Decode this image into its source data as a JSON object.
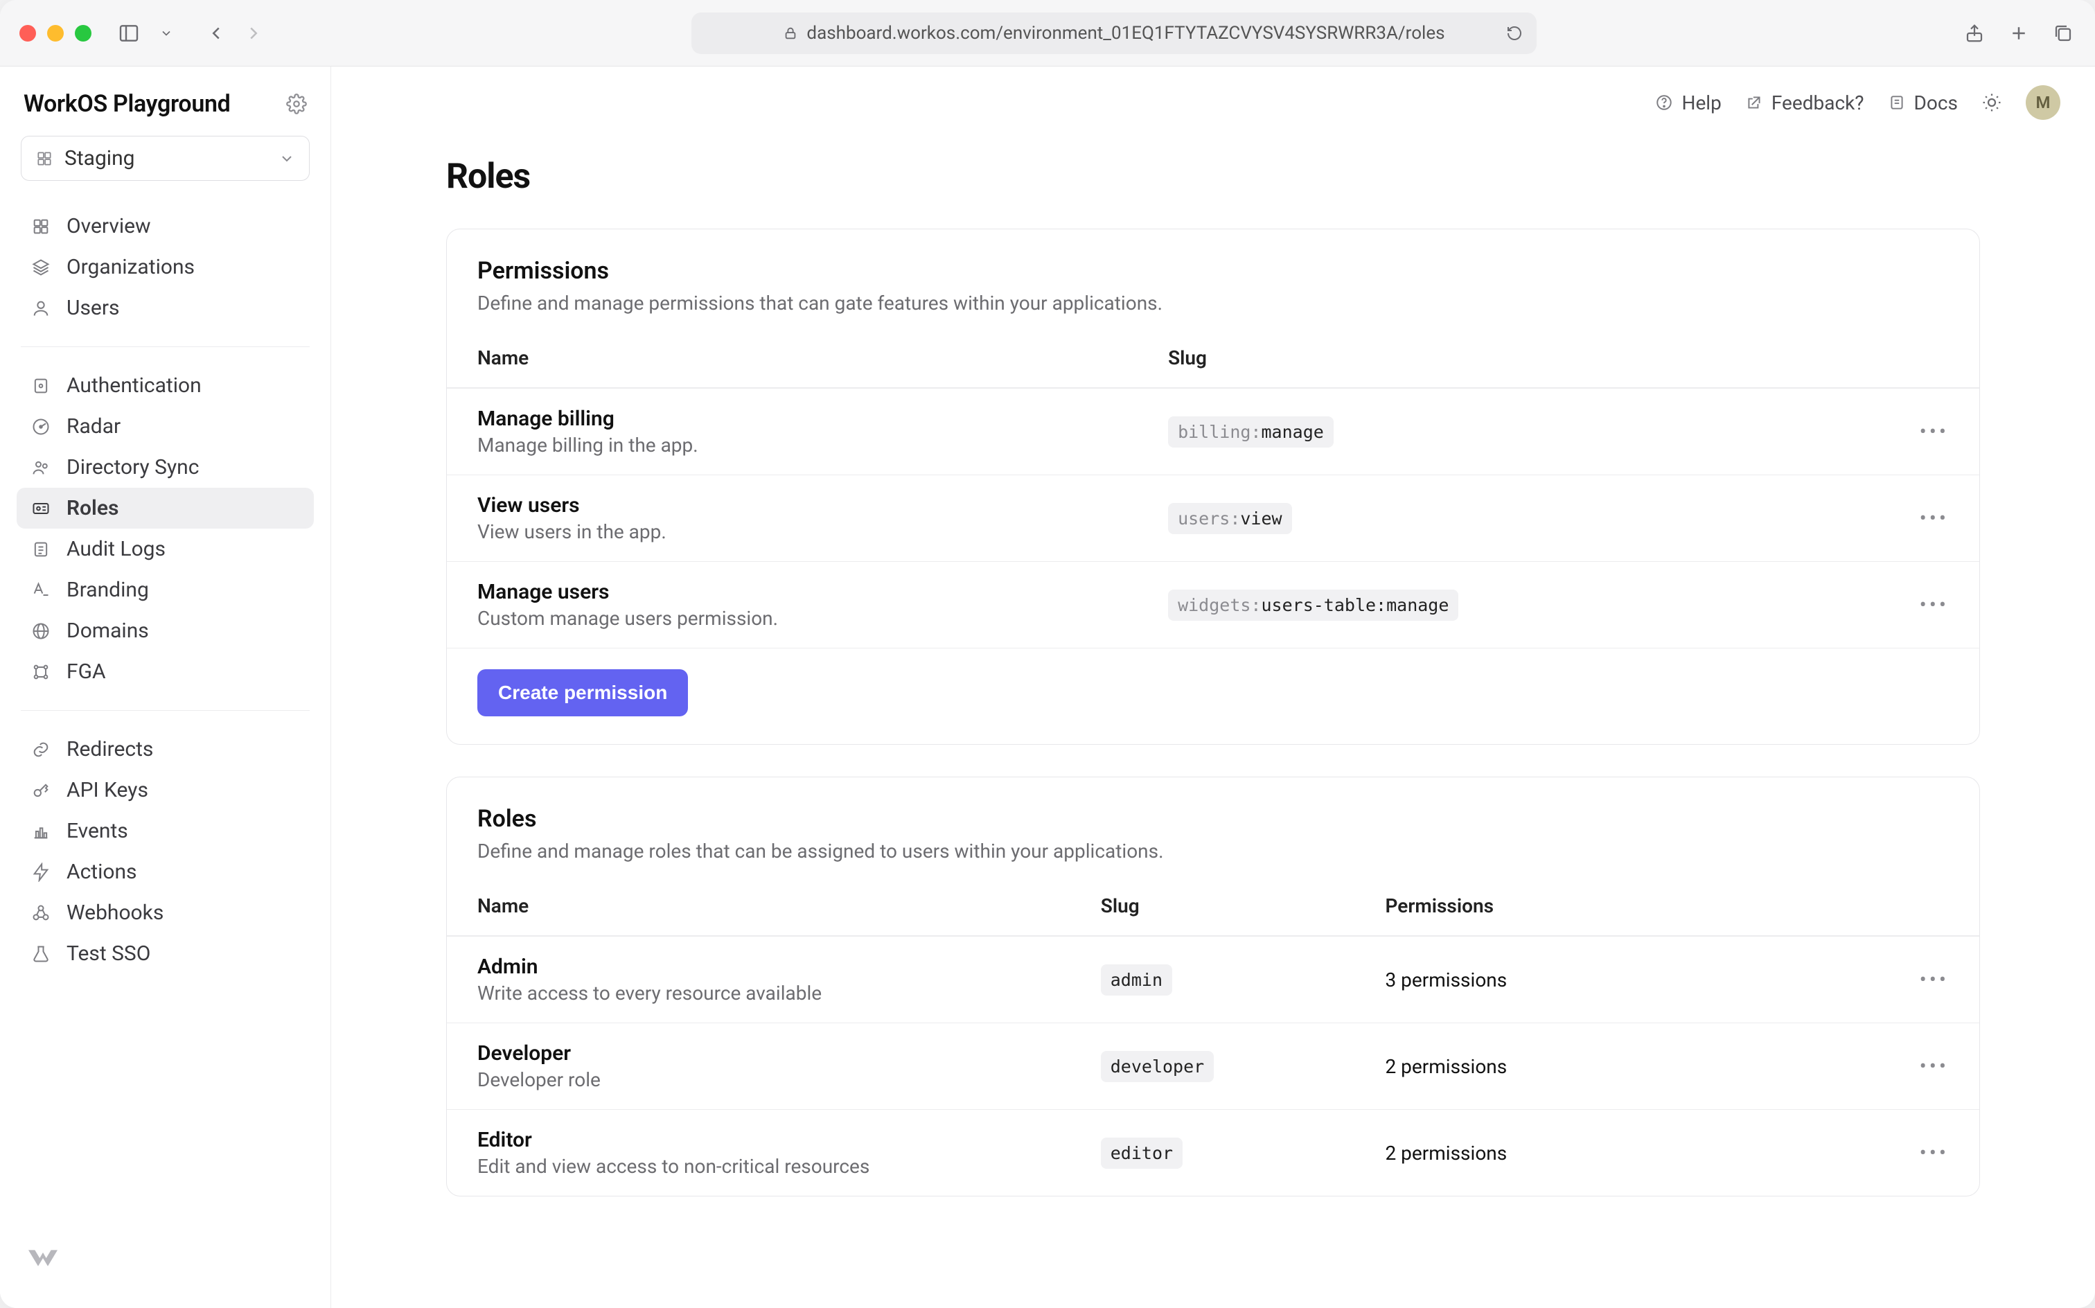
{
  "browser": {
    "url": "dashboard.workos.com/environment_01EQ1FTYTAZCVYSV4SYSRWRR3A/roles"
  },
  "sidebar": {
    "app_name": "WorkOS Playground",
    "environment": "Staging",
    "groups": [
      {
        "items": [
          {
            "icon": "grid",
            "label": "Overview"
          },
          {
            "icon": "stack",
            "label": "Organizations"
          },
          {
            "icon": "user",
            "label": "Users"
          }
        ]
      },
      {
        "items": [
          {
            "icon": "shield",
            "label": "Authentication"
          },
          {
            "icon": "radar",
            "label": "Radar"
          },
          {
            "icon": "sync",
            "label": "Directory Sync"
          },
          {
            "icon": "badge",
            "label": "Roles",
            "active": true
          },
          {
            "icon": "log",
            "label": "Audit Logs"
          },
          {
            "icon": "branding",
            "label": "Branding"
          },
          {
            "icon": "globe",
            "label": "Domains"
          },
          {
            "icon": "fga",
            "label": "FGA"
          }
        ]
      },
      {
        "items": [
          {
            "icon": "link",
            "label": "Redirects"
          },
          {
            "icon": "key",
            "label": "API Keys"
          },
          {
            "icon": "chart",
            "label": "Events"
          },
          {
            "icon": "bolt",
            "label": "Actions"
          },
          {
            "icon": "webhook",
            "label": "Webhooks"
          },
          {
            "icon": "test",
            "label": "Test SSO"
          }
        ]
      }
    ]
  },
  "topbar": {
    "help": "Help",
    "feedback": "Feedback?",
    "docs": "Docs",
    "avatar_initial": "M"
  },
  "page": {
    "title": "Roles"
  },
  "permissions_card": {
    "title": "Permissions",
    "subtitle": "Define and manage permissions that can gate features within your applications.",
    "columns": {
      "name": "Name",
      "slug": "Slug"
    },
    "rows": [
      {
        "name": "Manage billing",
        "desc": "Manage billing in the app.",
        "slug_muted": "billing:",
        "slug_strong": "manage"
      },
      {
        "name": "View users",
        "desc": "View users in the app.",
        "slug_muted": "users:",
        "slug_strong": "view"
      },
      {
        "name": "Manage users",
        "desc": "Custom manage users permission.",
        "slug_muted": "widgets:",
        "slug_strong": "users-table:manage"
      }
    ],
    "button": "Create permission"
  },
  "roles_card": {
    "title": "Roles",
    "subtitle": "Define and manage roles that can be assigned to users within your applications.",
    "columns": {
      "name": "Name",
      "slug": "Slug",
      "permissions": "Permissions"
    },
    "rows": [
      {
        "name": "Admin",
        "desc": "Write access to every resource available",
        "slug": "admin",
        "permissions": "3 permissions"
      },
      {
        "name": "Developer",
        "desc": "Developer role",
        "slug": "developer",
        "permissions": "2 permissions"
      },
      {
        "name": "Editor",
        "desc": "Edit and view access to non-critical resources",
        "slug": "editor",
        "permissions": "2 permissions"
      }
    ]
  }
}
